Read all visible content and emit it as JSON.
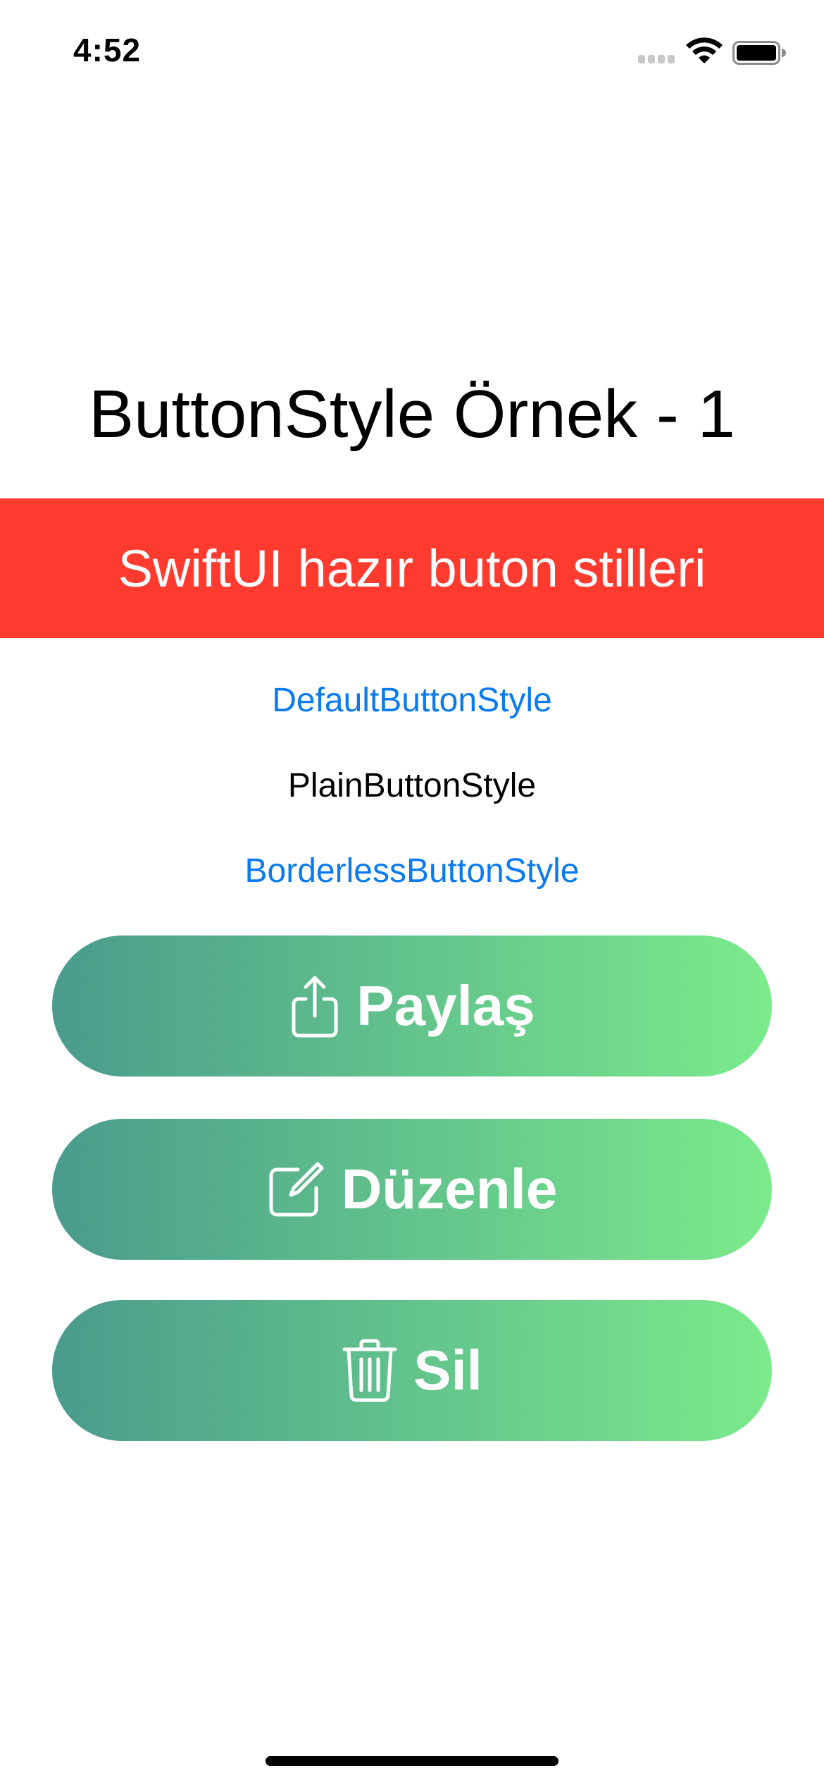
{
  "status_bar": {
    "time": "4:52",
    "icons": [
      "cell-signal-icon",
      "wifi-icon",
      "battery-icon"
    ]
  },
  "title": "ButtonStyle Örnek - 1",
  "banner": {
    "text": "SwiftUI hazır buton stilleri",
    "color": "#FF3B30"
  },
  "style_buttons": {
    "default_label": "DefaultButtonStyle",
    "plain_label": "PlainButtonStyle",
    "borderless_label": "BorderlessButtonStyle",
    "link_color": "#0A7AF0"
  },
  "actions": [
    {
      "label": "Paylaş",
      "icon": "share-icon"
    },
    {
      "label": "Düzenle",
      "icon": "edit-icon"
    },
    {
      "label": "Sil",
      "icon": "trash-icon"
    }
  ],
  "gradient": {
    "start": "#4A9B8C",
    "end": "#7BEB8C"
  }
}
